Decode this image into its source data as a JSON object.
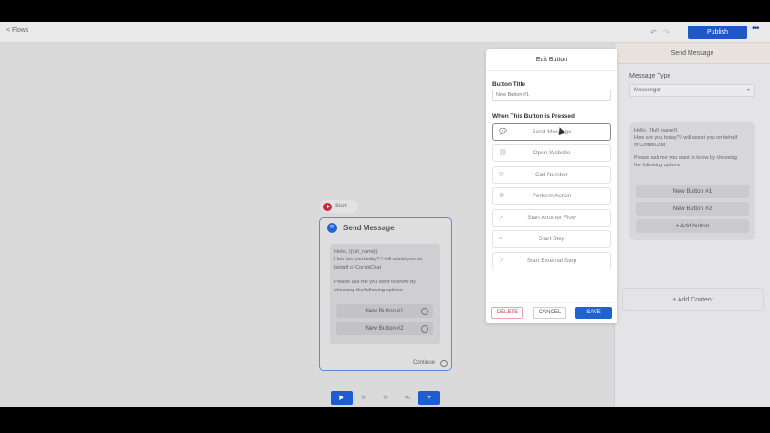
{
  "topbar": {
    "back_label": "< Flows",
    "undo_icon": "undo-icon",
    "redo_icon": "redo-icon",
    "publish_label": "Publish",
    "more_icon": "more-icon",
    "accent": "#1f57c7"
  },
  "node": {
    "start_label": "Start",
    "title": "Send Message",
    "message_lines": [
      "Hello, {{full_name}}",
      "How are you today? I will assist you on",
      "behalf of CombiChat",
      "",
      "Please ask me you want to know by",
      "choosing the following options"
    ],
    "buttons": [
      "New Button #1",
      "New Button #2"
    ],
    "continue_label": "Continue"
  },
  "toolbar": {
    "play_icon": "play-icon",
    "zoom_in_icon": "zoom-in-icon",
    "zoom_out_icon": "zoom-out-icon",
    "share_icon": "share-icon",
    "add_label": "+"
  },
  "modal": {
    "title": "Edit Button",
    "button_title_label": "Button Title",
    "button_title_value": "New Button #1",
    "when_pressed_label": "When This Button is Pressed",
    "options": [
      {
        "label": "Send Message",
        "icon": "chat-icon",
        "active": true
      },
      {
        "label": "Open Website",
        "icon": "link-icon",
        "active": false
      },
      {
        "label": "Call Number",
        "icon": "phone-icon",
        "active": false
      },
      {
        "label": "Perform Action",
        "icon": "gear-icon",
        "active": false
      },
      {
        "label": "Start Another Flow",
        "icon": "external-icon",
        "active": false
      },
      {
        "label": "Start Step",
        "icon": "step-icon",
        "active": false
      },
      {
        "label": "Start External Step",
        "icon": "external-icon",
        "active": false
      }
    ],
    "delete_label": "DELETE",
    "cancel_label": "CANCEL",
    "save_label": "SAVE"
  },
  "right_panel": {
    "header": "Send Message",
    "message_type_label": "Message Type",
    "message_type_value": "Messenger",
    "message_lines": [
      "Hello, {{full_name}}",
      "How are you today? I will assist you on behalf",
      "of CombiChat",
      "",
      "Please ask me you want to know by choosing",
      "the following options"
    ],
    "buttons": [
      "New Button #1",
      "New Button #2"
    ],
    "add_button_label": "+ Add button",
    "add_content_label": "+ Add Content"
  }
}
